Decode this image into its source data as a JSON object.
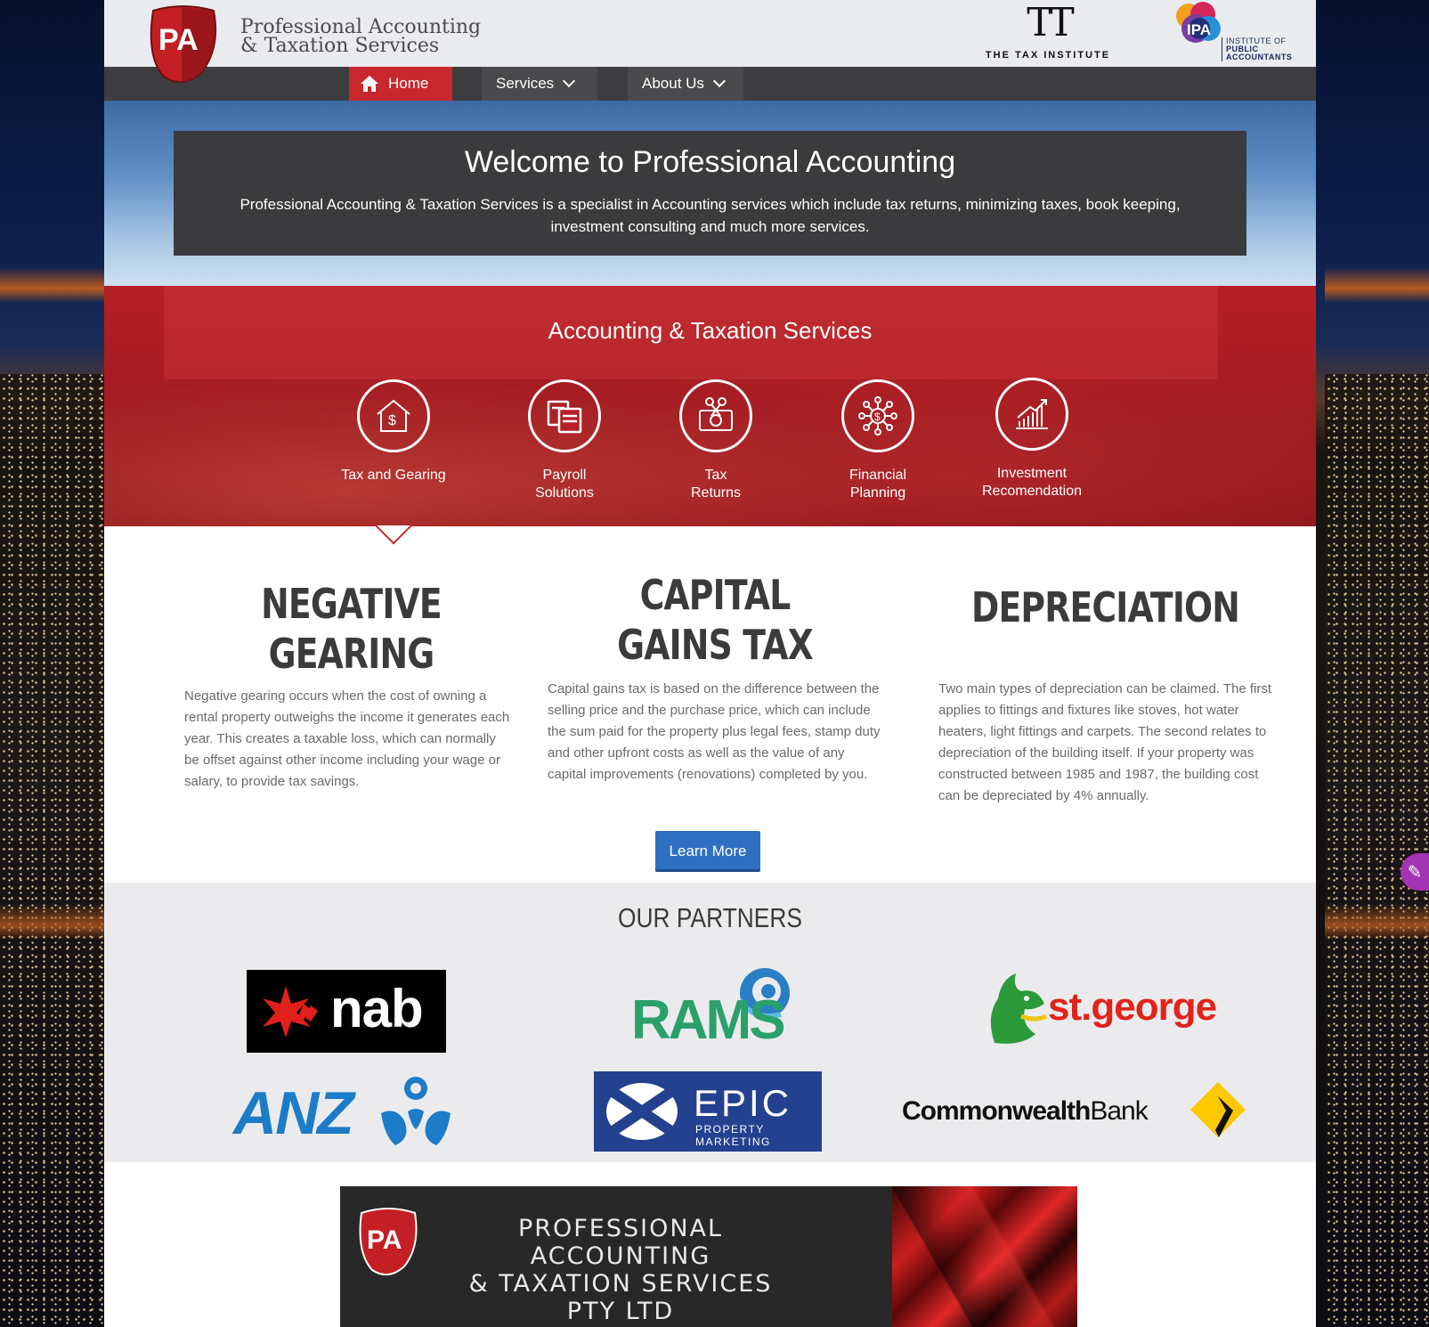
{
  "brand": {
    "logo_letters": "PA",
    "name_line1": "Professional Accounting",
    "name_line2": "& Taxation Services"
  },
  "affiliations": {
    "tax_institute_label": "THE TAX INSTITUTE",
    "ipa_abbr": "IPA",
    "ipa_line1": "INSTITUTE OF",
    "ipa_line2": "PUBLIC",
    "ipa_line3": "ACCOUNTANTS"
  },
  "nav": {
    "items": [
      {
        "label": "Home",
        "icon": "home-icon",
        "active": true
      },
      {
        "label": "Services",
        "icon": "chevron-down-icon"
      },
      {
        "label": "About Us",
        "icon": "chevron-down-icon"
      }
    ]
  },
  "hero": {
    "title": "Welcome to Professional Accounting",
    "body": "Professional Accounting & Taxation Services is a specialist in Accounting services which include tax returns, minimizing taxes, book keeping, investment consulting and much more services."
  },
  "services": {
    "heading": "Accounting & Taxation Services",
    "items": [
      {
        "label": "Tax and Gearing",
        "icon": "house-dollar-icon"
      },
      {
        "label": "Payroll Solutions",
        "icon": "documents-icon"
      },
      {
        "label": "Tax Returns",
        "icon": "money-cut-icon"
      },
      {
        "label": "Financial Planning",
        "icon": "network-dollar-icon"
      },
      {
        "label": "Investment Recomendation",
        "icon": "growth-chart-icon"
      }
    ]
  },
  "articles": [
    {
      "title": "NEGATIVE GEARING",
      "body": "Negative gearing occurs when the cost of owning a rental property outweighs the income it generates each year. This creates a taxable loss, which can normally be offset against other income including your wage or salary, to provide tax savings."
    },
    {
      "title": "CAPITAL GAINS TAX",
      "body": "Capital gains tax is based on the difference between the selling price and the purchase price, which can include the sum paid for the property plus legal fees, stamp duty and other upfront costs as well as the value of any capital improvements (renovations) completed by you."
    },
    {
      "title": "DEPRECIATION",
      "body": "Two main types of depreciation can be claimed. The first applies to fittings and fixtures like stoves, hot water heaters, light fittings and carpets. The second relates to depreciation of the building itself. If your property was constructed between 1985 and 1987, the building cost can be depreciated by 4% annually."
    }
  ],
  "learn_more_label": "Learn More",
  "partners": {
    "heading": "OUR PARTNERS",
    "items": [
      {
        "name": "nab"
      },
      {
        "name": "RAMS"
      },
      {
        "name": "st.george"
      },
      {
        "name": "ANZ"
      },
      {
        "name": "EPIC",
        "sub": "PROPERTY MARKETING"
      },
      {
        "name_bold": "Commonwealth",
        "name_light": "Bank"
      }
    ]
  },
  "footer": {
    "logo_letters": "PA",
    "line1": "PROFESSIONAL ACCOUNTING",
    "line2": "& TAXATION SERVICES",
    "line3": "PTY LTD"
  },
  "colors": {
    "brand_red": "#c8282d",
    "nav_dark": "#3d3c3f",
    "button_blue": "#2f6fc1"
  }
}
